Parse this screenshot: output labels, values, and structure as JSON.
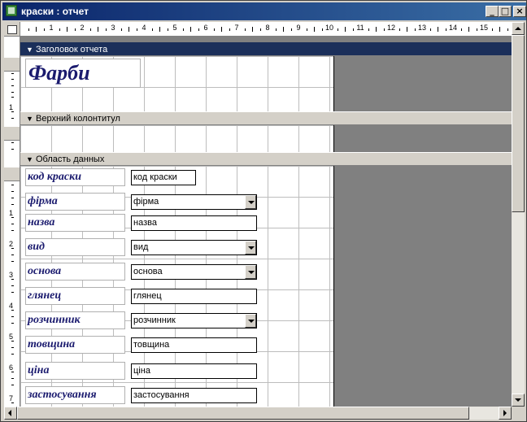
{
  "window": {
    "title": "краски : отчет",
    "icon": "report-icon",
    "controls": {
      "minimize": "_",
      "maximize": "□",
      "close": "×"
    }
  },
  "ruler": {
    "numbers": [
      "1",
      "2",
      "3",
      "4",
      "5",
      "6",
      "7",
      "8",
      "9",
      "10",
      "11",
      "12",
      "13",
      "14",
      "15"
    ],
    "vertical_numbers": [
      "1",
      "1",
      "2",
      "3",
      "4",
      "5",
      "6",
      "7"
    ]
  },
  "sections": {
    "report_header": "Заголовок отчета",
    "page_header": "Верхний колонтитул",
    "detail": "Область данных"
  },
  "report_title": "Фарби",
  "fields": [
    {
      "label": "код краски",
      "control": "код краски",
      "type": "text"
    },
    {
      "label": "фірма",
      "control": "фірма",
      "type": "combo"
    },
    {
      "label": "назва",
      "control": "назва",
      "type": "text"
    },
    {
      "label": "вид",
      "control": "вид",
      "type": "combo"
    },
    {
      "label": "основа",
      "control": "основа",
      "type": "combo"
    },
    {
      "label": "глянец",
      "control": "глянец",
      "type": "text"
    },
    {
      "label": "розчинник",
      "control": "розчинник",
      "type": "combo"
    },
    {
      "label": "товщина",
      "control": "товщина",
      "type": "text"
    },
    {
      "label": "ціна",
      "control": "ціна",
      "type": "text"
    },
    {
      "label": "застосування",
      "control": "застосування",
      "type": "text"
    }
  ]
}
